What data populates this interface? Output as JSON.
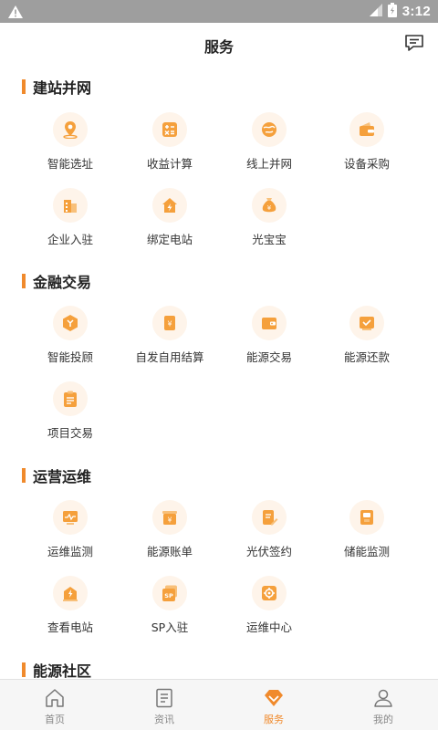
{
  "status_bar": {
    "time": "3:12",
    "battery_icon": "battery-icon",
    "signal_icon": "signal-icon",
    "warning_icon": "warning-icon"
  },
  "header": {
    "title": "服务",
    "message_icon": "message-icon"
  },
  "colors": {
    "accent": "#f08a2c",
    "icon_bg": "#fef4ea",
    "icon_fill": "#f5a03c",
    "status_bar": "#9e9e9e",
    "tab_bg": "#f6f6f6"
  },
  "sections": [
    {
      "title": "建站并网",
      "items": [
        {
          "label": "智能选址",
          "icon": "location-pin-icon"
        },
        {
          "label": "收益计算",
          "icon": "calculator-icon"
        },
        {
          "label": "线上并网",
          "icon": "globe-icon"
        },
        {
          "label": "设备采购",
          "icon": "wallet-icon"
        },
        {
          "label": "企业入驻",
          "icon": "building-icon"
        },
        {
          "label": "绑定电站",
          "icon": "house-lightning-icon"
        },
        {
          "label": "光宝宝",
          "icon": "money-bag-icon"
        }
      ]
    },
    {
      "title": "金融交易",
      "items": [
        {
          "label": "智能投顾",
          "icon": "investment-cube-icon"
        },
        {
          "label": "自发自用结算",
          "icon": "bill-yuan-icon"
        },
        {
          "label": "能源交易",
          "icon": "wallet-card-icon"
        },
        {
          "label": "能源还款",
          "icon": "repayment-icon"
        },
        {
          "label": "项目交易",
          "icon": "clipboard-icon"
        }
      ]
    },
    {
      "title": "运营运维",
      "items": [
        {
          "label": "运维监测",
          "icon": "monitor-icon"
        },
        {
          "label": "能源账单",
          "icon": "invoice-icon"
        },
        {
          "label": "光伏签约",
          "icon": "contract-sign-icon"
        },
        {
          "label": "储能监测",
          "icon": "battery-storage-icon"
        },
        {
          "label": "查看电站",
          "icon": "station-view-icon"
        },
        {
          "label": "SP入驻",
          "icon": "sp-badge-icon"
        },
        {
          "label": "运维中心",
          "icon": "settings-center-icon"
        }
      ]
    },
    {
      "title": "能源社区",
      "items": []
    }
  ],
  "tabs": [
    {
      "label": "首页",
      "icon": "home-icon",
      "active": false
    },
    {
      "label": "资讯",
      "icon": "news-icon",
      "active": false
    },
    {
      "label": "服务",
      "icon": "service-diamond-icon",
      "active": true
    },
    {
      "label": "我的",
      "icon": "profile-icon",
      "active": false
    }
  ]
}
